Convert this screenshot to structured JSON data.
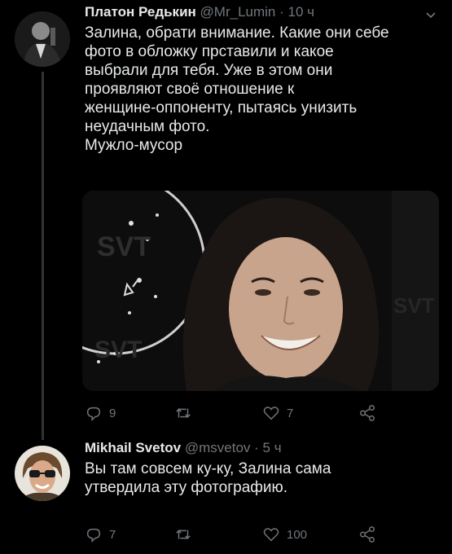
{
  "tweets": [
    {
      "display_name": "Платон Редькин",
      "handle": "@Mr_Lumin",
      "separator": "·",
      "time": "10 ч",
      "text": [
        "Залина, обрати внимание. Какие они себе",
        "фото в обложку прставили и какое",
        "выбрали для тебя. Уже в этом они",
        "проявляют своё отношение к",
        "женщине-оппоненту, пытаясь унизить",
        "неудачным фото.",
        "Мужло-мусор"
      ],
      "media_watermark": "SVT",
      "counts": {
        "replies": "9",
        "retweets": "",
        "likes": "7"
      }
    },
    {
      "display_name": "Mikhail Svetov",
      "handle": "@msvetov",
      "separator": "·",
      "time": "5 ч",
      "text": [
        "Вы там совсем ку-ку, Залина сама",
        "утвердила эту фотографию."
      ],
      "counts": {
        "replies": "7",
        "retweets": "",
        "likes": "100"
      }
    }
  ],
  "colors": {
    "background": "#000000",
    "primary_text": "#e7e9ea",
    "secondary_text": "#71767b",
    "thread_line": "#2f3336"
  },
  "icons": [
    "chevron-down-icon",
    "reply-icon",
    "retweet-icon",
    "like-icon",
    "share-icon"
  ]
}
